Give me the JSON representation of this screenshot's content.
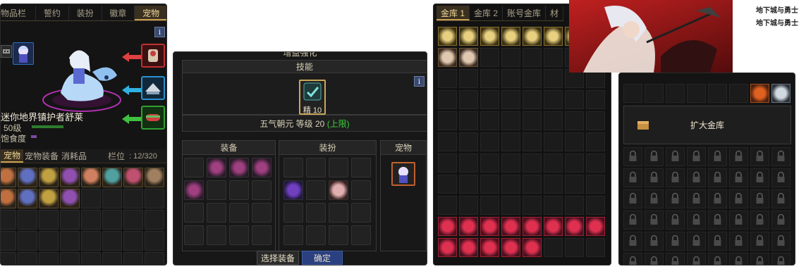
{
  "pet_panel": {
    "tabs": [
      "物品栏",
      "誓约",
      "装扮",
      "徽章",
      "宠物"
    ],
    "active_tab": "宠物",
    "info_label": "i",
    "pet_name": "迷你地界镇护者舒莱",
    "pet_level": "50级",
    "satiety_label": "饱食度",
    "level_progress": 0.9,
    "satiety_progress": 0.15,
    "sub_tabs": [
      "宠物",
      "宠物装备",
      "消耗品"
    ],
    "active_sub_tab": "宠物",
    "slots_label": "栏位",
    "slots_value": ": 12/320",
    "arrow_colors": [
      "#e04040",
      "#30b0e0",
      "#40c040"
    ],
    "inventory_items": 12
  },
  "enhance_panel": {
    "title": "增益强化",
    "skill_header": "技能",
    "skill_grade": "精 10",
    "skill_name": "五气朝元 等级 20",
    "skill_limit": "(上限)",
    "info_label": "i",
    "sections": {
      "equipment": "装备",
      "avatar": "装扮",
      "pet": "宠物"
    },
    "select_equipment_button": "选择装备",
    "confirm_button": "确定"
  },
  "storage_panel": {
    "tabs": [
      "金库 1",
      "金库 2",
      "账号金库",
      "材"
    ],
    "active_tab": "金库 1",
    "top_items": 9,
    "locked_items": 13
  },
  "storage_right": {
    "expand_label": "扩大金库",
    "locked_rows": 6
  },
  "banner": {
    "logo_text_1": "地下城与勇士",
    "logo_text_2": "地下城与勇士"
  }
}
